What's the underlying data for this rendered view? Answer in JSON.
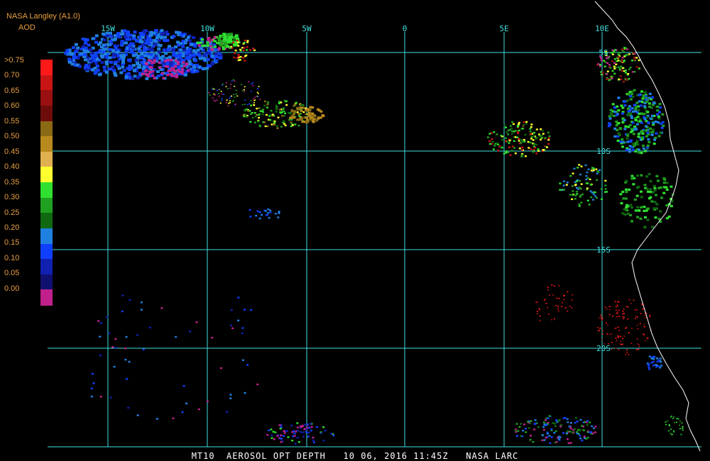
{
  "header": {
    "source": "NASA Langley (A1.0)",
    "product": "AOD"
  },
  "legend": {
    "labels": [
      ">0.75",
      "0.70",
      "0.65",
      "0.60",
      "0.55",
      "0.50",
      "0.45",
      "0.40",
      "0.35",
      "0.30",
      "0.25",
      "0.20",
      "0.15",
      "0.10",
      "0.05",
      "0.00"
    ],
    "colors": [
      "#ff1a1a",
      "#c81414",
      "#9a1010",
      "#6e0c0c",
      "#8a6a14",
      "#b88a1e",
      "#e0b050",
      "#ffff30",
      "#30e030",
      "#20a020",
      "#106810",
      "#2080e0",
      "#1040ff",
      "#1020b0",
      "#101070",
      "#c0208c"
    ]
  },
  "grid": {
    "lon_labels": [
      "15W",
      "10W",
      "5W",
      "0",
      "5E",
      "10E"
    ],
    "lat_labels": [
      "5S",
      "10S",
      "15S",
      "20S"
    ],
    "line_color": "#40e0e0"
  },
  "footer": {
    "text": "MT10  AEROSOL OPT DEPTH   10 06, 2016 11:45Z   NASA LARC"
  },
  "colors": {
    "background": "#000000",
    "coastline": "#ffffff",
    "label": "#e8a040"
  }
}
